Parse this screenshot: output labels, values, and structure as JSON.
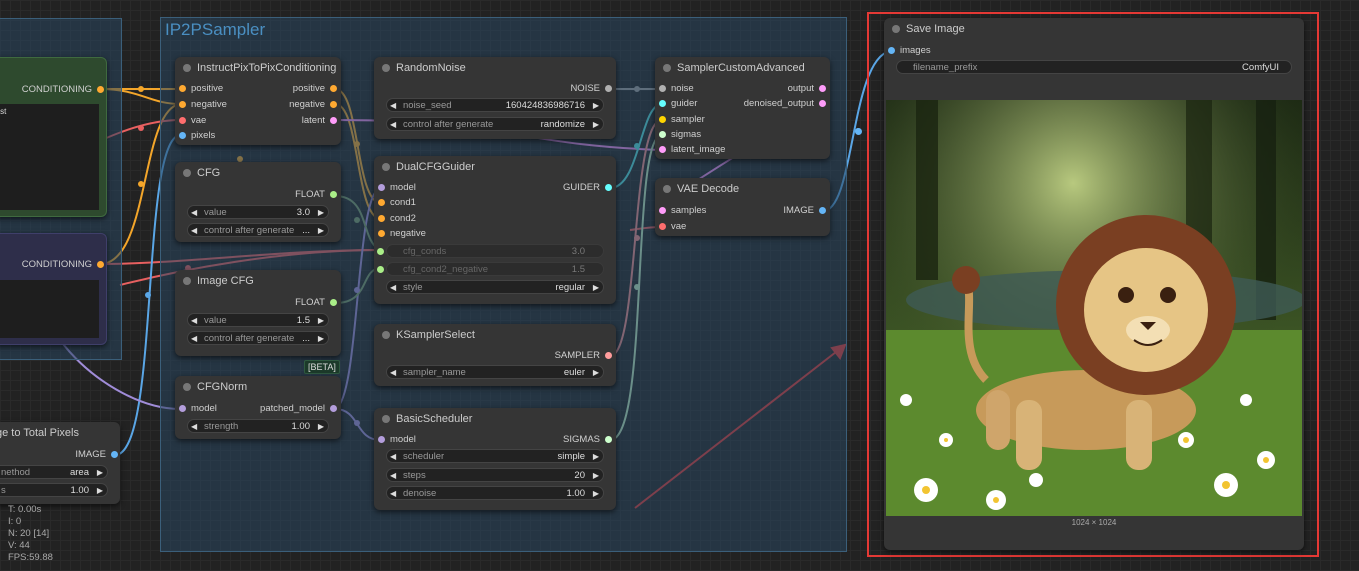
{
  "group": {
    "title": "IP2PSampler"
  },
  "left_nodes": {
    "pos_output": "CONDITIONING",
    "pos_text": "rest",
    "neg_output": "CONDITIONING",
    "scale_title": "ge to Total Pixels",
    "scale_output": "IMAGE",
    "scale_method_label": "nethod",
    "scale_method_value": "area",
    "scale_mp_label": "s",
    "scale_mp_value": "1.00"
  },
  "ip2p": {
    "title": "InstructPixToPixConditioning",
    "inputs": [
      "positive",
      "negative",
      "vae",
      "pixels"
    ],
    "outputs": [
      "positive",
      "negative",
      "latent"
    ]
  },
  "cfg": {
    "title": "CFG",
    "output": "FLOAT",
    "value_label": "value",
    "value": "3.0",
    "control_label": "control after generate",
    "control_value": "..."
  },
  "image_cfg": {
    "title": "Image CFG",
    "output": "FLOAT",
    "value_label": "value",
    "value": "1.5",
    "control_label": "control after generate",
    "control_value": "...",
    "badge": "[BETA]"
  },
  "cfgnorm": {
    "title": "CFGNorm",
    "input": "model",
    "output": "patched_model",
    "strength_label": "strength",
    "strength": "1.00"
  },
  "random_noise": {
    "title": "RandomNoise",
    "output": "NOISE",
    "seed_label": "noise_seed",
    "seed": "160424836986716",
    "control_label": "control after generate",
    "control_value": "randomize"
  },
  "dual_cfg": {
    "title": "DualCFGGuider",
    "output": "GUIDER",
    "inputs": [
      "model",
      "cond1",
      "cond2",
      "negative"
    ],
    "cfg_conds_label": "cfg_conds",
    "cfg_conds": "3.0",
    "cfg_cond2_label": "cfg_cond2_negative",
    "cfg_cond2": "1.5",
    "style_label": "style",
    "style": "regular"
  },
  "ksampler_select": {
    "title": "KSamplerSelect",
    "output": "SAMPLER",
    "sampler_label": "sampler_name",
    "sampler": "euler"
  },
  "basic_scheduler": {
    "title": "BasicScheduler",
    "output": "SIGMAS",
    "input": "model",
    "scheduler_label": "scheduler",
    "scheduler": "simple",
    "steps_label": "steps",
    "steps": "20",
    "denoise_label": "denoise",
    "denoise": "1.00"
  },
  "sampler_custom": {
    "title": "SamplerCustomAdvanced",
    "inputs": [
      "noise",
      "guider",
      "sampler",
      "sigmas",
      "latent_image"
    ],
    "outputs": [
      "output",
      "denoised_output"
    ]
  },
  "vae_decode": {
    "title": "VAE Decode",
    "inputs": [
      "samples",
      "vae"
    ],
    "output": "IMAGE"
  },
  "save_image": {
    "title": "Save Image",
    "input": "images",
    "prefix_label": "filename_prefix",
    "prefix": "ComfyUI",
    "dims": "1024 × 1024"
  },
  "stats": {
    "line1": "T: 0.00s",
    "line2": "I: 0",
    "line3": "N: 20 [14]",
    "line4": "V: 44",
    "line5": "FPS:59.88"
  },
  "colors": {
    "conditioning": "#ffa931",
    "model": "#b39ddb",
    "vae": "#ff6e6e",
    "image": "#64b5f6",
    "latent": "#ff9cf9",
    "float": "#aaee88",
    "noise": "#b0b0b0",
    "guider": "#66ffff",
    "sampler": "#ffd500",
    "sigmas": "#cdffcd",
    "highlight": "#e53935"
  }
}
